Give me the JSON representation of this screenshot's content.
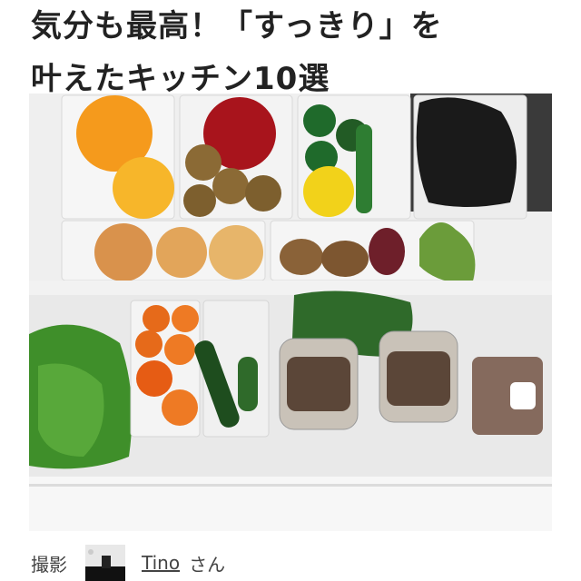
{
  "article": {
    "title_line1": "気分も最高！「すっきり」を",
    "title_line2": "叶えたキッチン10選"
  },
  "credit": {
    "label": "撮影",
    "username": "Tino",
    "honorific": "さん"
  },
  "colors": {
    "title": "#222222",
    "credit_text": "#444444"
  }
}
